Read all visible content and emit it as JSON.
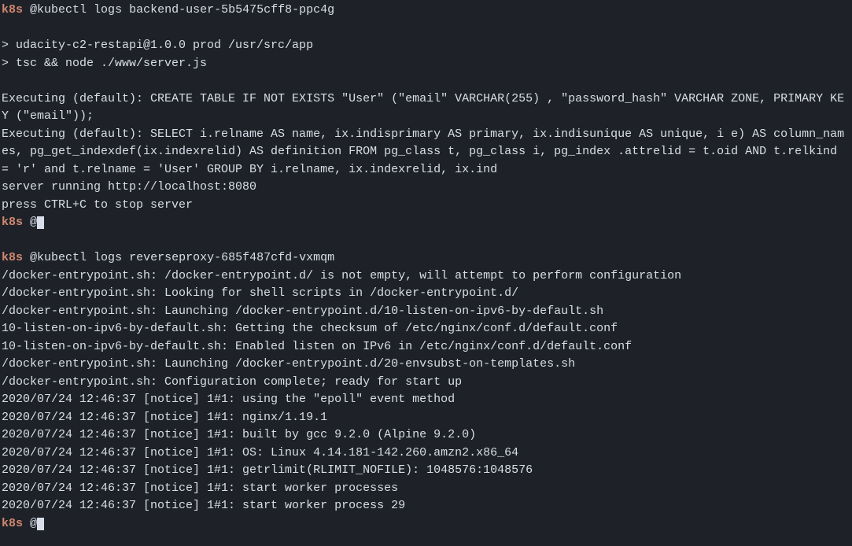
{
  "prompt": "k8s",
  "at": "@",
  "cmd1": "kubectl logs backend-user-5b5475cff8-ppc4g",
  "out1_line1": "> udacity-c2-restapi@1.0.0 prod /usr/src/app",
  "out1_line2": "> tsc && node ./www/server.js",
  "out1_line3": "Executing (default): CREATE TABLE IF NOT EXISTS \"User\" (\"email\" VARCHAR(255) , \"password_hash\" VARCHAR ZONE, PRIMARY KEY (\"email\"));",
  "out1_line4": "Executing (default): SELECT i.relname AS name, ix.indisprimary AS primary, ix.indisunique AS unique, i e) AS column_names, pg_get_indexdef(ix.indexrelid) AS definition FROM pg_class t, pg_class i, pg_index .attrelid = t.oid AND t.relkind = 'r' and t.relname = 'User' GROUP BY i.relname, ix.indexrelid, ix.ind",
  "out1_line5": "server running http://localhost:8080",
  "out1_line6": "press CTRL+C to stop server",
  "cmd2": "kubectl logs reverseproxy-685f487cfd-vxmqm",
  "out2_line1": "/docker-entrypoint.sh: /docker-entrypoint.d/ is not empty, will attempt to perform configuration",
  "out2_line2": "/docker-entrypoint.sh: Looking for shell scripts in /docker-entrypoint.d/",
  "out2_line3": "/docker-entrypoint.sh: Launching /docker-entrypoint.d/10-listen-on-ipv6-by-default.sh",
  "out2_line4": "10-listen-on-ipv6-by-default.sh: Getting the checksum of /etc/nginx/conf.d/default.conf",
  "out2_line5": "10-listen-on-ipv6-by-default.sh: Enabled listen on IPv6 in /etc/nginx/conf.d/default.conf",
  "out2_line6": "/docker-entrypoint.sh: Launching /docker-entrypoint.d/20-envsubst-on-templates.sh",
  "out2_line7": "/docker-entrypoint.sh: Configuration complete; ready for start up",
  "out2_line8": "2020/07/24 12:46:37 [notice] 1#1: using the \"epoll\" event method",
  "out2_line9": "2020/07/24 12:46:37 [notice] 1#1: nginx/1.19.1",
  "out2_line10": "2020/07/24 12:46:37 [notice] 1#1: built by gcc 9.2.0 (Alpine 9.2.0)",
  "out2_line11": "2020/07/24 12:46:37 [notice] 1#1: OS: Linux 4.14.181-142.260.amzn2.x86_64",
  "out2_line12": "2020/07/24 12:46:37 [notice] 1#1: getrlimit(RLIMIT_NOFILE): 1048576:1048576",
  "out2_line13": "2020/07/24 12:46:37 [notice] 1#1: start worker processes",
  "out2_line14": "2020/07/24 12:46:37 [notice] 1#1: start worker process 29"
}
